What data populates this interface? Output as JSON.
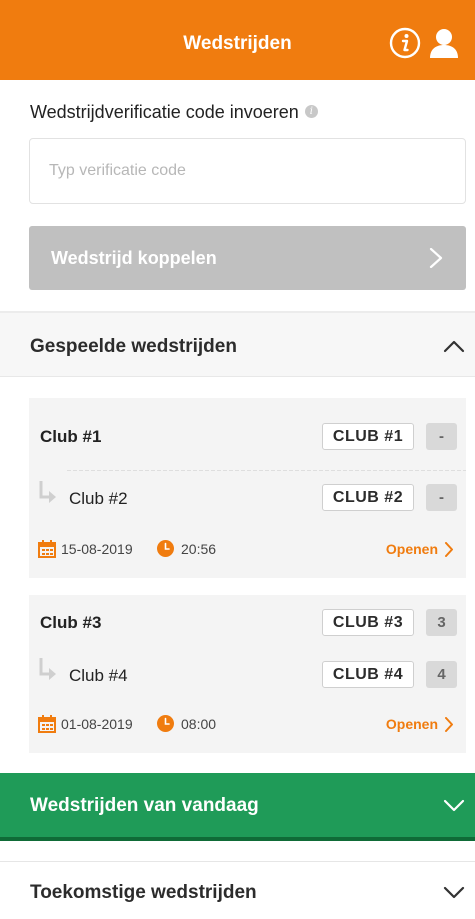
{
  "header": {
    "title": "Wedstrijden",
    "info_icon": "info-circle-icon",
    "user_icon": "user-icon",
    "background_color": "#f07c0f"
  },
  "verify": {
    "label": "Wedstrijdverificatie code invoeren",
    "label_icon": "info-icon",
    "input_value": "",
    "input_placeholder": "Typ verificatie code",
    "button_label": "Wedstrijd koppelen",
    "button_icon": "chevron-right-icon"
  },
  "sections": {
    "played": {
      "title": "Gespeelde wedstrijden",
      "icon": "chevron-up-icon",
      "expanded": true
    },
    "today": {
      "title": "Wedstrijden van vandaag",
      "icon": "chevron-down-icon",
      "color": "#1f9b58"
    },
    "future": {
      "title": "Toekomstige wedstrijden",
      "icon": "chevron-down-icon"
    }
  },
  "matches": [
    {
      "home": {
        "name": "Club #1",
        "tag": "CLUB #1",
        "score": "-"
      },
      "away": {
        "name": "Club #2",
        "tag": "CLUB #2",
        "score": "-"
      },
      "date": "15-08-2019",
      "time": "20:56",
      "open_label": "Openen"
    },
    {
      "home": {
        "name": "Club #3",
        "tag": "CLUB #3",
        "score": "3"
      },
      "away": {
        "name": "Club #4",
        "tag": "CLUB #4",
        "score": "4"
      },
      "date": "01-08-2019",
      "time": "08:00",
      "open_label": "Openen"
    }
  ],
  "colors": {
    "accent": "#f07c0f",
    "today_green": "#1f9b58",
    "button_disabled": "#c0c0c0"
  }
}
